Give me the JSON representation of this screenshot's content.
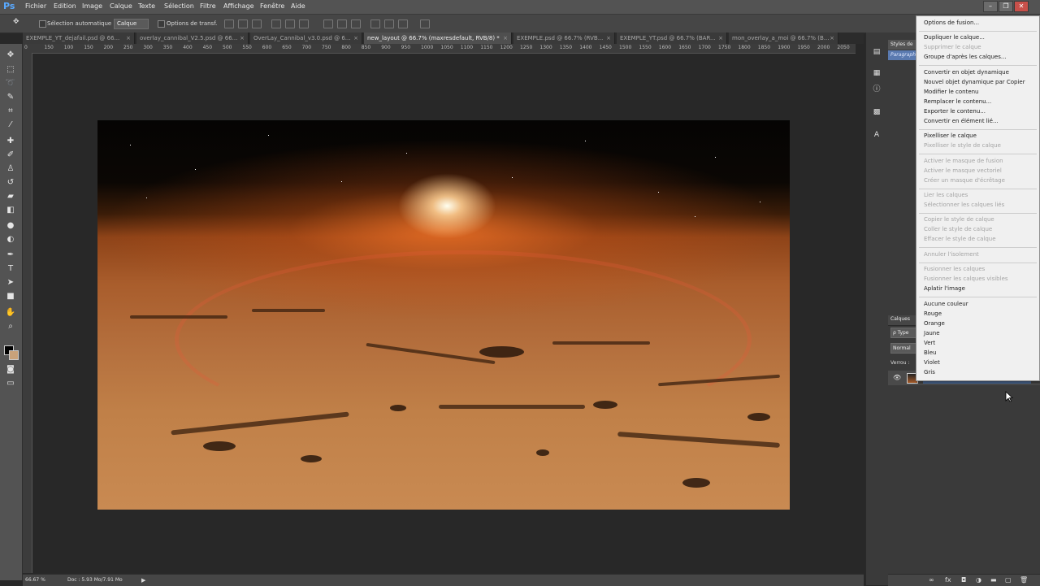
{
  "app": {
    "logo": "Ps"
  },
  "menu": [
    "Fichier",
    "Edition",
    "Image",
    "Calque",
    "Texte",
    "Sélection",
    "Filtre",
    "Affichage",
    "Fenêtre",
    "Aide"
  ],
  "window_controls": {
    "min": "–",
    "max": "❐",
    "close": "✕"
  },
  "options_bar": {
    "auto_select_label": "Sélection automatique :",
    "auto_select_value": "Calque",
    "transform_label": "Options de transf."
  },
  "tabs": [
    {
      "label": "EXEMPLE_YT_dejafail.psd @ 66...",
      "close": "×"
    },
    {
      "label": "overlay_cannibal_V2.5.psd @ 66...",
      "close": "×"
    },
    {
      "label": "OverLay_Cannibal_v3.0.psd @ 6...",
      "close": "×"
    },
    {
      "label": "new_layout @ 66.7% (maxresdefault, RVB/8) *",
      "close": "×"
    },
    {
      "label": "EXEMPLE.psd @ 66.7% (RVB...",
      "close": "×"
    },
    {
      "label": "EXEMPLE_YT.psd @ 66.7% (BAR...",
      "close": "×"
    },
    {
      "label": "mon_overlay_a_moi @ 66.7% (B...",
      "close": "×"
    }
  ],
  "ruler_h": [
    "0",
    "150",
    "100",
    "150",
    "200",
    "250",
    "300",
    "350",
    "400",
    "450",
    "500",
    "550",
    "600",
    "650",
    "700",
    "750",
    "800",
    "850",
    "900",
    "950",
    "1000",
    "1050",
    "1100",
    "1150",
    "1200",
    "1250",
    "1300",
    "1350",
    "1400",
    "1450",
    "1500",
    "1550",
    "1600",
    "1650",
    "1700",
    "1750",
    "1800",
    "1850",
    "1900",
    "1950",
    "2000",
    "2050"
  ],
  "status": {
    "zoom": "66.67 %",
    "doc": "Doc : 5.93 Mo/7.91 Mo",
    "arrow": "▶"
  },
  "right_panel": {
    "styles_tab": "Styles de",
    "para_tab": "Paragraph",
    "layers_tab": "Calques",
    "search_label": "ρ Type",
    "blend_mode": "Normal",
    "lock_label": "Verrou :"
  },
  "context_menu": [
    {
      "label": "Options de fusion...",
      "disabled": false
    },
    {
      "sep": true
    },
    {
      "label": "Dupliquer le calque...",
      "disabled": false
    },
    {
      "label": "Supprimer le calque",
      "disabled": true
    },
    {
      "label": "Groupe d'après les calques...",
      "disabled": false
    },
    {
      "sep": true
    },
    {
      "label": "Convertir en objet dynamique",
      "disabled": false
    },
    {
      "label": "Nouvel objet dynamique par Copier",
      "disabled": false
    },
    {
      "label": "Modifier le contenu",
      "disabled": false
    },
    {
      "label": "Remplacer le contenu...",
      "disabled": false
    },
    {
      "label": "Exporter le contenu...",
      "disabled": false
    },
    {
      "label": "Convertir en élément lié...",
      "disabled": false
    },
    {
      "sep": true
    },
    {
      "label": "Pixelliser le calque",
      "disabled": false
    },
    {
      "label": "Pixelliser le style de calque",
      "disabled": true
    },
    {
      "sep": true
    },
    {
      "label": "Activer le masque de fusion",
      "disabled": true
    },
    {
      "label": "Activer le masque vectoriel",
      "disabled": true
    },
    {
      "label": "Créer un masque d'écrêtage",
      "disabled": true
    },
    {
      "sep": true
    },
    {
      "label": "Lier les calques",
      "disabled": true
    },
    {
      "label": "Sélectionner les calques liés",
      "disabled": true
    },
    {
      "sep": true
    },
    {
      "label": "Copier le style de calque",
      "disabled": true
    },
    {
      "label": "Coller le style de calque",
      "disabled": true
    },
    {
      "label": "Effacer le style de calque",
      "disabled": true
    },
    {
      "sep": true
    },
    {
      "label": "Annuler l'isolement",
      "disabled": true
    },
    {
      "sep": true
    },
    {
      "label": "Fusionner les calques",
      "disabled": true
    },
    {
      "label": "Fusionner les calques visibles",
      "disabled": true
    },
    {
      "label": "Aplatir l'image",
      "disabled": false
    },
    {
      "sep": true
    },
    {
      "label": "Aucune couleur",
      "disabled": false
    },
    {
      "label": "Rouge",
      "disabled": false
    },
    {
      "label": "Orange",
      "disabled": false
    },
    {
      "label": "Jaune",
      "disabled": false
    },
    {
      "label": "Vert",
      "disabled": false
    },
    {
      "label": "Bleu",
      "disabled": false
    },
    {
      "label": "Violet",
      "disabled": false
    },
    {
      "label": "Gris",
      "disabled": false
    }
  ],
  "colors": {
    "menubar": "#535353",
    "panel": "#3a3a3a",
    "selection": "#4f6f9f",
    "menu_bg": "#f0f0f0"
  }
}
